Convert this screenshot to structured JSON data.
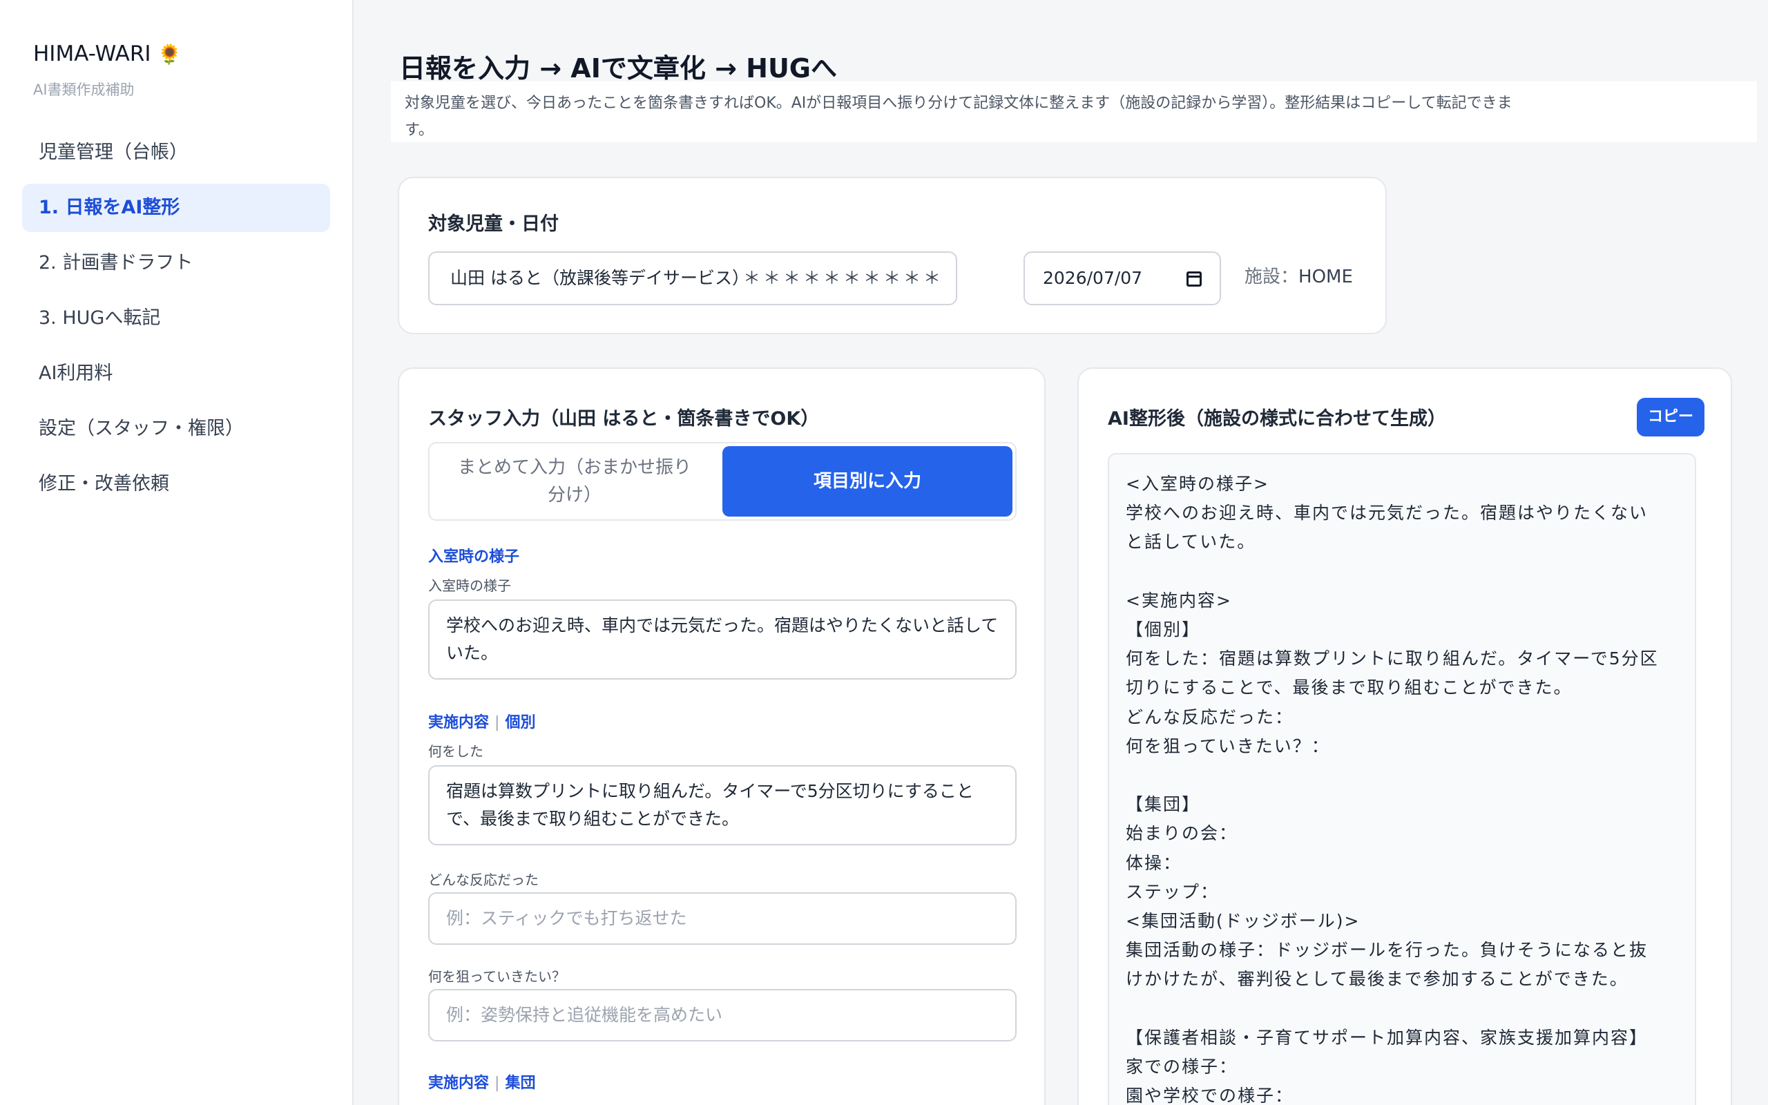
{
  "sidebar": {
    "brand": "HIMA-WARI",
    "brand_icon": "🌻",
    "subtitle": "AI書類作成補助",
    "items": [
      {
        "label": "児童管理（台帳）",
        "active": false
      },
      {
        "label": "1. 日報をAI整形",
        "active": true
      },
      {
        "label": "2. 計画書ドラフト",
        "active": false
      },
      {
        "label": "3. HUGへ転記",
        "active": false
      },
      {
        "label": "AI利用料",
        "active": false
      },
      {
        "label": "設定（スタッフ・権限）",
        "active": false
      },
      {
        "label": "修正・改善依頼",
        "active": false
      }
    ]
  },
  "header": {
    "title": "日報を入力 → AIで文章化 → HUGへ",
    "description": "対象児童を選び、今日あったことを箇条書きすればOK。AIが日報項目へ振り分けて記録文体に整えます（施設の記録から学習）。整形結果はコピーして転記できます。"
  },
  "target": {
    "label": "対象児童・日付",
    "child_select": "山田 はると（放課後等デイサービス）",
    "child_mask": "＊＊＊＊＊＊＊＊＊＊",
    "date": "2026/07/07",
    "facility_label": "施設：",
    "facility_value": "HOME"
  },
  "staff_input": {
    "title": "スタッフ入力（山田 はると・箇条書きでOK）",
    "tab_bulk": "まとめて入力（おまかせ振り分け）",
    "tab_items": "項目別に入力",
    "sections": {
      "arrival": {
        "title": "入室時の様子",
        "field_label": "入室時の様子",
        "value": "学校へのお迎え時、車内では元気だった。宿題はやりたくないと話していた。"
      },
      "individual": {
        "title": "実施内容",
        "sub": "個別",
        "did_label": "何をした",
        "did_value": "宿題は算数プリントに取り組んだ。タイマーで5分区切りにすることで、最後まで取り組むことができた。",
        "reaction_label": "どんな反応だった",
        "reaction_placeholder": "例：スティックでも打ち返せた",
        "aim_label": "何を狙っていきたい？",
        "aim_placeholder": "例：姿勢保持と追従機能を高めたい"
      },
      "group": {
        "title": "実施内容",
        "sub": "集団"
      }
    }
  },
  "ai_output": {
    "title": "AI整形後（施設の様式に合わせて生成）",
    "copy_label": "コピー",
    "lines": [
      "<入室時の様子>",
      "学校へのお迎え時、車内では元気だった。宿題はやりたくない",
      "と話していた。",
      "",
      "<実施内容>",
      "【個別】",
      "何をした：宿題は算数プリントに取り組んだ。タイマーで5分区",
      "切りにすることで、最後まで取り組むことができた。",
      "どんな反応だった：",
      "何を狙っていきたい？：",
      "",
      "【集団】",
      "始まりの会：",
      "体操：",
      "ステップ：",
      "<集団活動(ドッジボール)>",
      "集団活動の様子：ドッジボールを行った。負けそうになると抜",
      "けかけたが、審判役として最後まで参加することができた。",
      "",
      "【保護者相談・子育てサポート加算内容、家族支援加算内容】",
      "家での様子：",
      "園や学校での様子："
    ]
  },
  "colors": {
    "accent": "#2563eb",
    "active_bg": "#eaf1fe",
    "text": "#1f2937"
  }
}
